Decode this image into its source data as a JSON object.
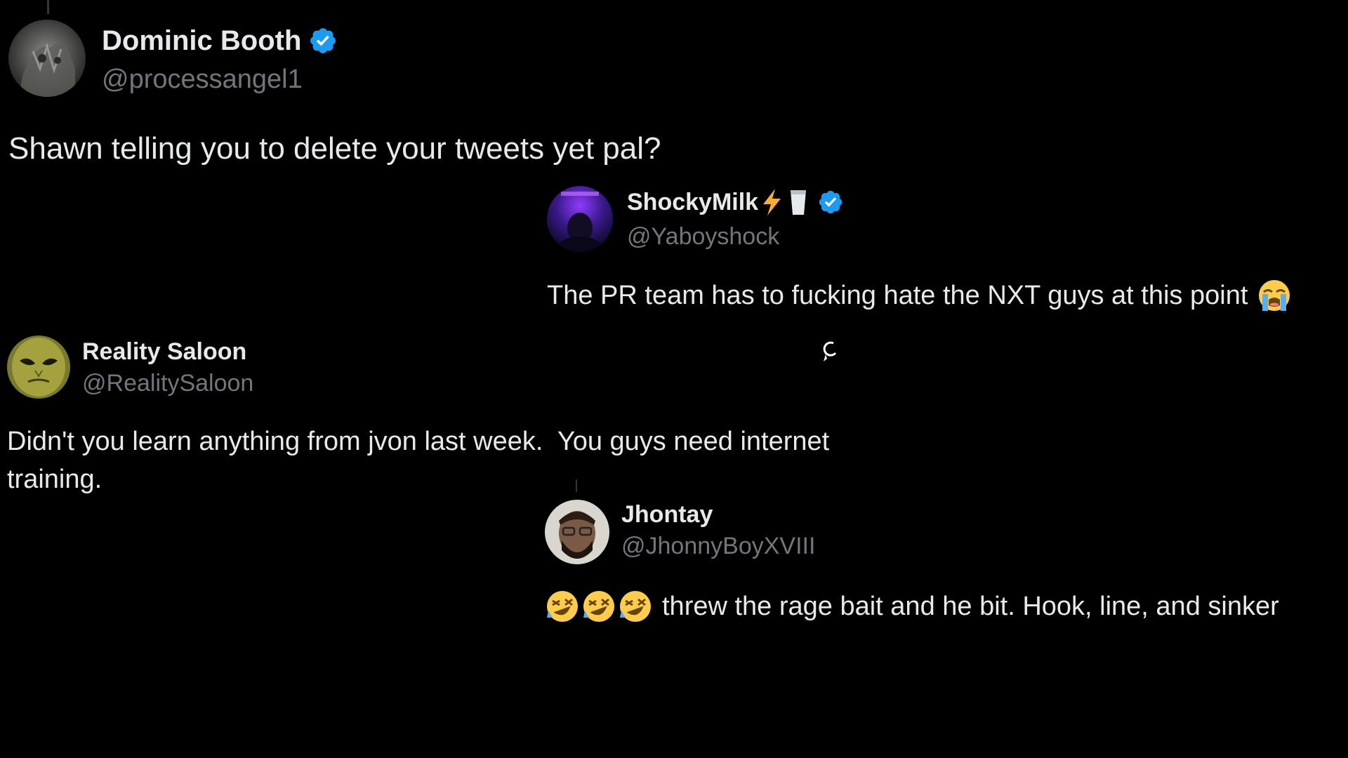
{
  "tweets": [
    {
      "display_name": "Dominic Booth",
      "handle": "@processangel1",
      "verified": true,
      "text": "Shawn telling you to delete your tweets yet pal?"
    },
    {
      "display_name": "ShockyMilk",
      "name_emojis": [
        "⚡",
        "🥛"
      ],
      "handle": "@Yaboyshock",
      "verified": true,
      "text": "The PR team has to fucking hate the NXT guys at this point",
      "trailing_emoji": "😭"
    },
    {
      "display_name": "Reality Saloon",
      "handle": "@RealitySaloon",
      "verified": false,
      "text": "Didn't you learn anything from jvon last week.  You guys need internet training."
    },
    {
      "display_name": "Jhontay",
      "handle": "@JhonnyBoyXVIII",
      "verified": false,
      "leading_emojis": [
        "🤣",
        "🤣",
        "🤣"
      ],
      "text": "threw the rage bait and he bit. Hook, line, and sinker"
    }
  ],
  "colors": {
    "background": "#000000",
    "text_primary": "#e7e9ea",
    "text_secondary": "#71767b",
    "verified_blue": "#1d9bf0",
    "thread_line": "#333639"
  },
  "icons": {
    "verified": "verified-badge-icon",
    "cursor": "loading-cursor-icon"
  }
}
